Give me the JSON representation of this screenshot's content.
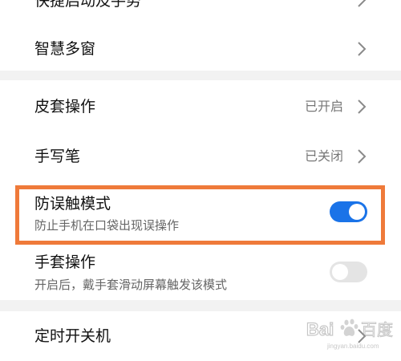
{
  "group1": {
    "items": [
      {
        "label": "快捷启动及手势"
      },
      {
        "label": "智慧多窗"
      }
    ]
  },
  "group2": {
    "items": [
      {
        "label": "皮套操作",
        "status": "已开启"
      },
      {
        "label": "手写笔",
        "status": "已关闭"
      },
      {
        "label": "防误触模式",
        "description": "防止手机在口袋出现误操作",
        "toggle": "on"
      },
      {
        "label": "手套操作",
        "description": "开启后，戴手套滑动屏幕触发该模式",
        "toggle": "off"
      }
    ]
  },
  "group3": {
    "items": [
      {
        "label": "定时开关机"
      }
    ]
  },
  "colors": {
    "toggle_on": "#1a73e8",
    "toggle_off": "#e4e4e4",
    "highlight": "#ef7a3a"
  },
  "watermark": {
    "text": "Bai百度",
    "subtext": "jingyan.baidu.com"
  }
}
